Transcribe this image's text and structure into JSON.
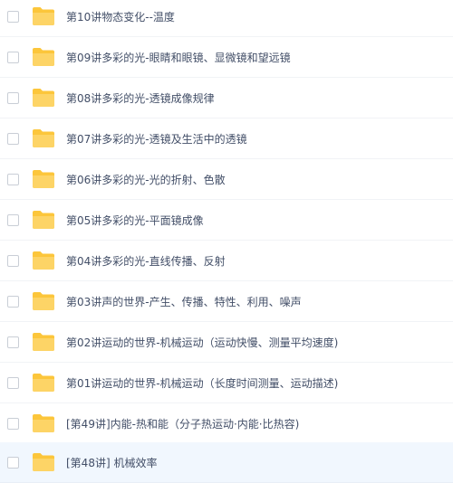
{
  "files": [
    {
      "name": "第10讲物态变化--温度"
    },
    {
      "name": "第09讲多彩的光-眼睛和眼镜、显微镜和望远镜"
    },
    {
      "name": "第08讲多彩的光-透镜成像规律"
    },
    {
      "name": "第07讲多彩的光-透镜及生活中的透镜"
    },
    {
      "name": "第06讲多彩的光-光的折射、色散"
    },
    {
      "name": "第05讲多彩的光-平面镜成像"
    },
    {
      "name": "第04讲多彩的光-直线传播、反射"
    },
    {
      "name": "第03讲声的世界-产生、传播、特性、利用、噪声"
    },
    {
      "name": "第02讲运动的世界-机械运动（运动快慢、测量平均速度)"
    },
    {
      "name": "第01讲运动的世界-机械运动（长度时间测量、运动描述)"
    },
    {
      "name": "[第49讲]内能-热和能（分子热运动·内能·比热容)"
    },
    {
      "name": "[第48讲] 机械效率"
    }
  ],
  "icons": {
    "folder": "folder-icon",
    "checkbox": "checkbox"
  },
  "colors": {
    "folder": "#fcc63b",
    "text": "#424e67",
    "hover_row": "#f1f7fe"
  }
}
